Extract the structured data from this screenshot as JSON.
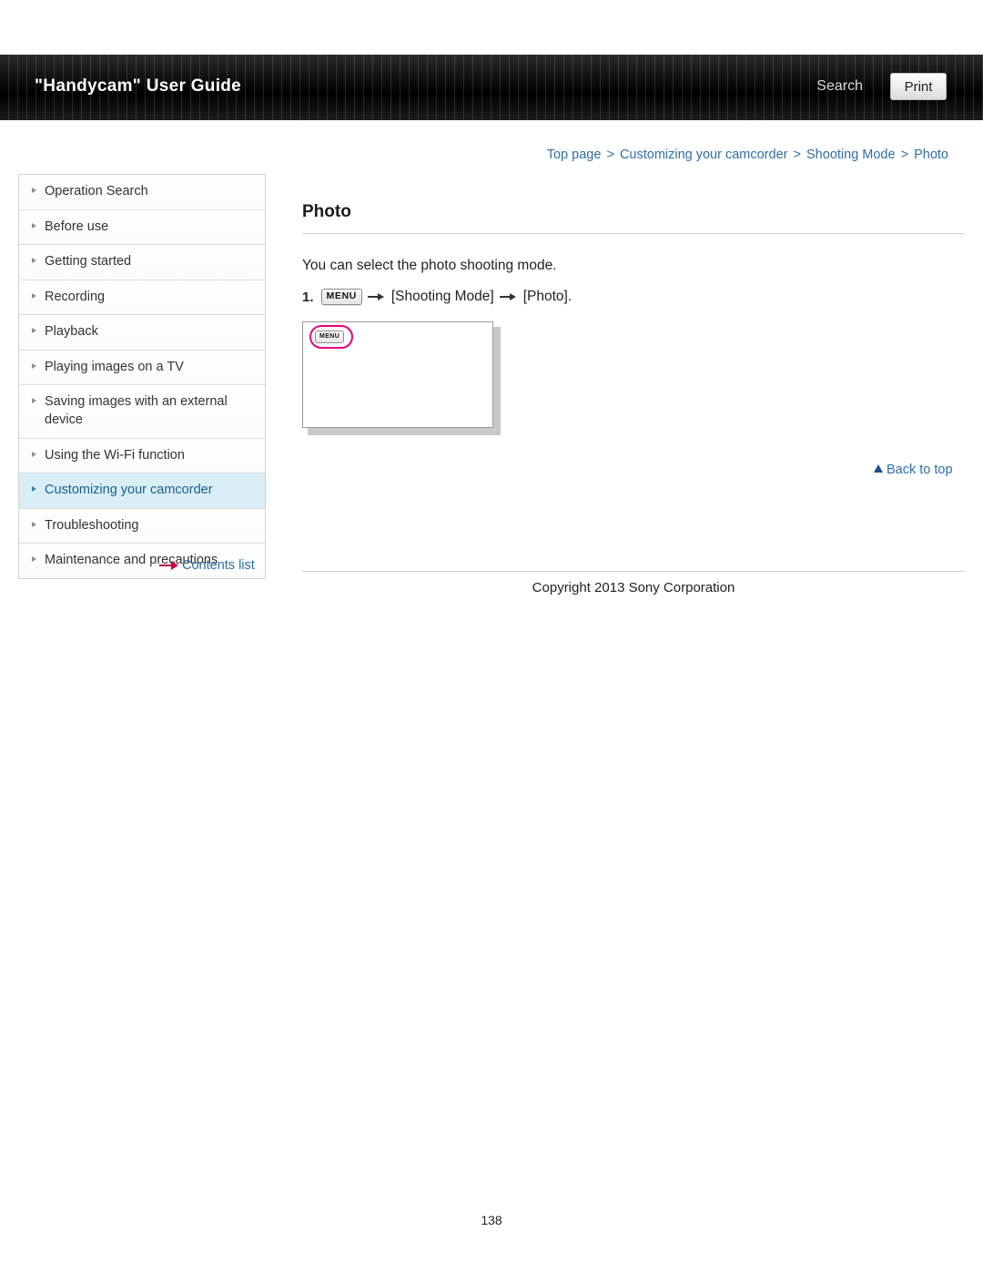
{
  "header": {
    "title": "\"Handycam\" User Guide",
    "search_label": "Search",
    "print_label": "Print"
  },
  "breadcrumb": {
    "items": [
      "Top page",
      "Customizing your camcorder",
      "Shooting Mode",
      "Photo"
    ],
    "separator": ">"
  },
  "sidebar": {
    "items": [
      {
        "label": "Operation Search",
        "active": false
      },
      {
        "label": "Before use",
        "active": false
      },
      {
        "label": "Getting started",
        "active": false
      },
      {
        "label": "Recording",
        "active": false
      },
      {
        "label": "Playback",
        "active": false
      },
      {
        "label": "Playing images on a TV",
        "active": false
      },
      {
        "label": "Saving images with an external device",
        "active": false
      },
      {
        "label": "Using the Wi-Fi function",
        "active": false
      },
      {
        "label": "Customizing your camcorder",
        "active": true
      },
      {
        "label": "Troubleshooting",
        "active": false
      },
      {
        "label": "Maintenance and precautions",
        "active": false
      }
    ],
    "contents_list_label": "Contents list"
  },
  "main": {
    "title": "Photo",
    "lead": "You can select the photo shooting mode.",
    "step_number": "1.",
    "menu_chip_label": "MENU",
    "step_part_1": "[Shooting Mode]",
    "step_part_2": "[Photo].",
    "screen_menu_label": "MENU",
    "back_to_top_label": "Back to top"
  },
  "footer": {
    "copyright": "Copyright 2013 Sony Corporation",
    "page_number": "138"
  },
  "colors": {
    "link": "#2f6ea5",
    "active_bg": "#d9eef7",
    "highlight": "#e6007e",
    "header_bg": "#000000"
  }
}
